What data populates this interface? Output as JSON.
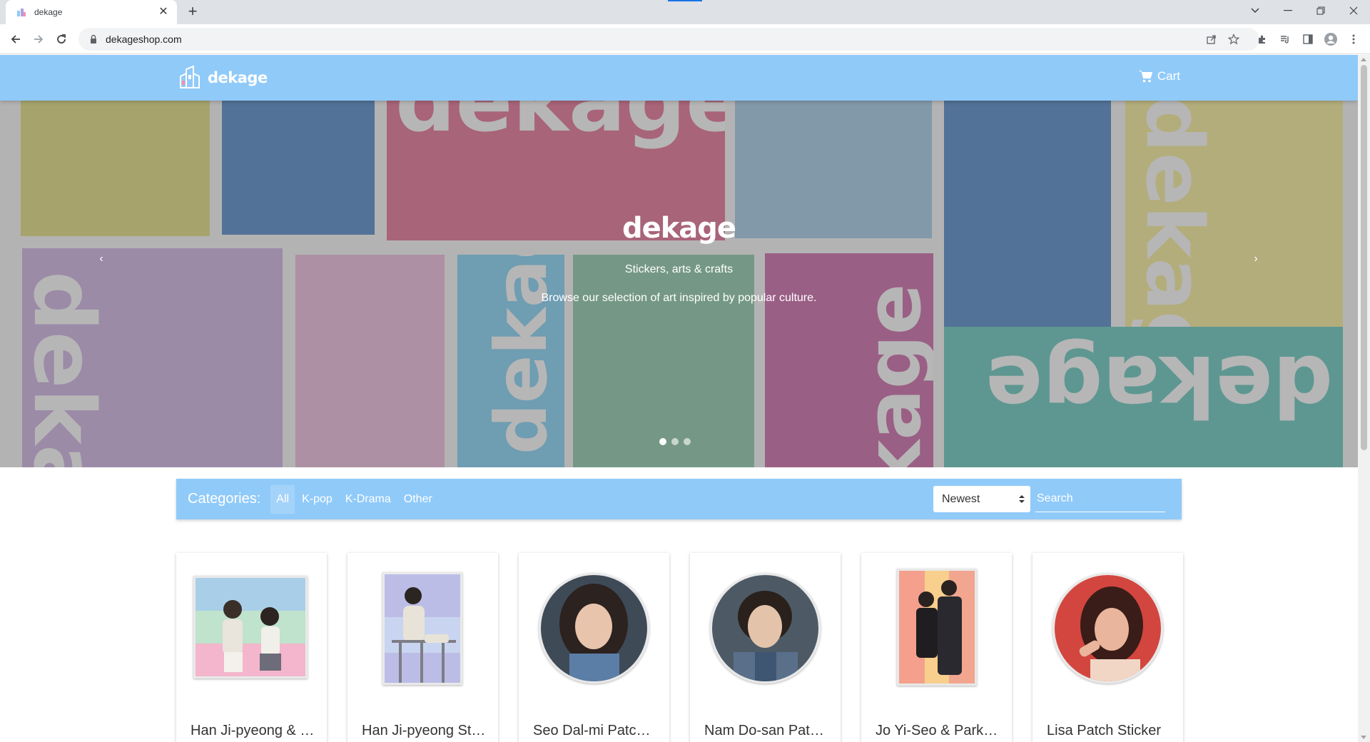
{
  "browser": {
    "tab_title": "dekage",
    "url": "dekageshop.com",
    "new_tab_label": "+",
    "tab_close_label": "✕"
  },
  "site": {
    "logo_text": "dekage",
    "cart_label": "Cart"
  },
  "hero": {
    "title": "dekage",
    "subtitle": "Stickers, arts & crafts",
    "description": "Browse our selection of art inspired by popular culture.",
    "slide_count": 3,
    "active_slide": 1,
    "prev_label": "‹",
    "next_label": "›"
  },
  "filters": {
    "categories_label": "Categories:",
    "categories": [
      "All",
      "K-pop",
      "K-Drama",
      "Other"
    ],
    "active_category": "All",
    "sort_value": "Newest",
    "search_placeholder": "Search"
  },
  "products": [
    {
      "title": "Han Ji-pyeong & Seo Dal-mi Sticker"
    },
    {
      "title": "Han Ji-pyeong Sticker"
    },
    {
      "title": "Seo Dal-mi Patch Sticker"
    },
    {
      "title": "Nam Do-san Patch Sticker"
    },
    {
      "title": "Jo Yi-Seo & Park Sae-ro-yi Sticker"
    },
    {
      "title": "Lisa Patch Sticker"
    }
  ],
  "colors": {
    "brand": "#90caf9",
    "chrome_tabbar": "#dee1e6"
  }
}
